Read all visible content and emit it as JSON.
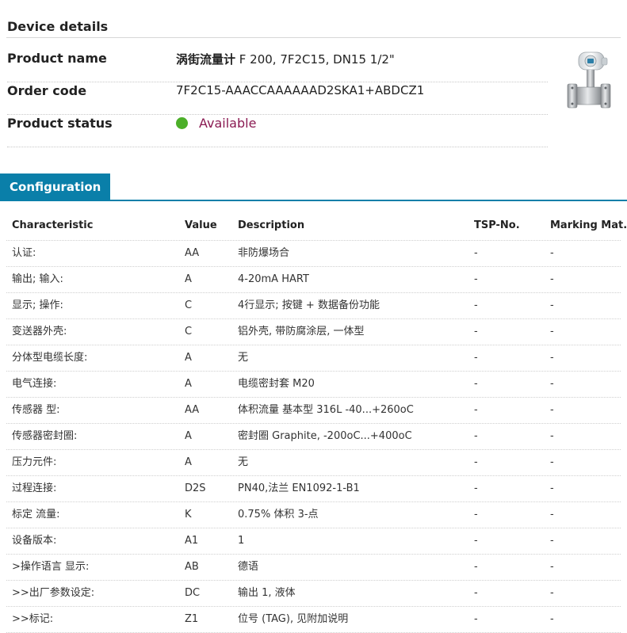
{
  "device": {
    "section_title": "Device details",
    "product_name_label": "Product name",
    "product_name_cn": "涡街流量计",
    "product_name_rest": " F 200, 7F2C15, DN15 1/2\"",
    "order_code_label": "Order code",
    "order_code": "7F2C15-AAACCAAAAAAD2SKA1+ABDCZ1",
    "status_label": "Product status",
    "status_value": "Available",
    "status_color": "#4caf29"
  },
  "config": {
    "tab_label": "Configuration",
    "accent_color": "#0a7fa9",
    "headers": [
      "Characteristic",
      "Value",
      "Description",
      "TSP-No.",
      "Marking Mat."
    ],
    "rows": [
      [
        "认证:",
        "AA",
        "非防爆场合",
        "-",
        "-"
      ],
      [
        "输出; 输入:",
        "A",
        "4-20mA HART",
        "-",
        "-"
      ],
      [
        "显示; 操作:",
        "C",
        "4行显示; 按键 + 数据备份功能",
        "-",
        "-"
      ],
      [
        "变送器外壳:",
        "C",
        "铝外壳, 带防腐涂层, 一体型",
        "-",
        "-"
      ],
      [
        "分体型电缆长度:",
        "A",
        "无",
        "-",
        "-"
      ],
      [
        "电气连接:",
        "A",
        "电缆密封套 M20",
        "-",
        "-"
      ],
      [
        "传感器 型:",
        "AA",
        "体积流量 基本型 316L -40...+260oC",
        "-",
        "-"
      ],
      [
        "传感器密封圈:",
        "A",
        "密封圈 Graphite, -200oC...+400oC",
        "-",
        "-"
      ],
      [
        "压力元件:",
        "A",
        "无",
        "-",
        "-"
      ],
      [
        "过程连接:",
        "D2S",
        "PN40,法兰 EN1092-1-B1",
        "-",
        "-"
      ],
      [
        "标定 流量:",
        "K",
        "0.75% 体积 3-点",
        "-",
        "-"
      ],
      [
        "设备版本:",
        "A1",
        "1",
        "-",
        "-"
      ],
      [
        ">操作语言 显示:",
        "AB",
        "德语",
        "-",
        "-"
      ],
      [
        ">>出厂参数设定:",
        "DC",
        "输出 1, 液体",
        "-",
        "-"
      ],
      [
        ">>标记:",
        "Z1",
        "位号 (TAG), 见附加说明",
        "-",
        "-"
      ]
    ]
  }
}
